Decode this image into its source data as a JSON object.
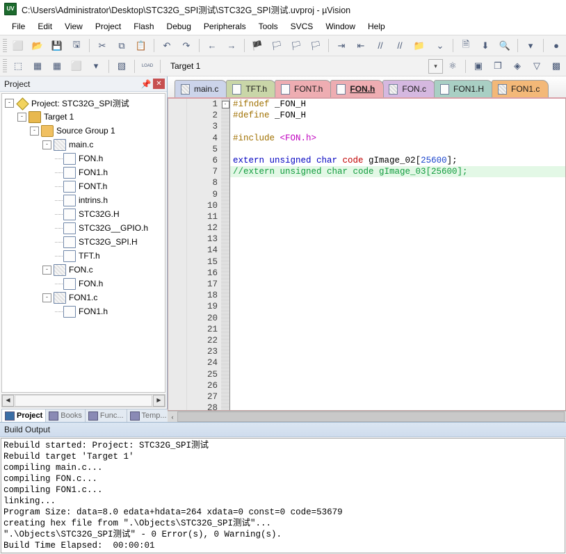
{
  "window": {
    "title": "C:\\Users\\Administrator\\Desktop\\STC32G_SPI测试\\STC32G_SPI测试.uvproj - µVision",
    "logo": "uv5-logo"
  },
  "menubar": {
    "items": [
      {
        "label": "File"
      },
      {
        "label": "Edit"
      },
      {
        "label": "View"
      },
      {
        "label": "Project"
      },
      {
        "label": "Flash"
      },
      {
        "label": "Debug"
      },
      {
        "label": "Peripherals"
      },
      {
        "label": "Tools"
      },
      {
        "label": "SVCS"
      },
      {
        "label": "Window"
      },
      {
        "label": "Help"
      }
    ]
  },
  "toolbar_main": {
    "buttons": [
      {
        "icon": "new-file-icon",
        "glyph": "⬜"
      },
      {
        "icon": "open-folder-icon",
        "glyph": "📂"
      },
      {
        "icon": "save-icon",
        "glyph": "💾"
      },
      {
        "icon": "save-all-icon",
        "glyph": "🖫"
      },
      {
        "icon": "cut-icon",
        "glyph": "✂"
      },
      {
        "icon": "copy-icon",
        "glyph": "⧉"
      },
      {
        "icon": "paste-icon",
        "glyph": "📋"
      },
      {
        "icon": "undo-icon",
        "glyph": "↶"
      },
      {
        "icon": "redo-icon",
        "glyph": "↷"
      },
      {
        "icon": "navigate-back-icon",
        "glyph": "←"
      },
      {
        "icon": "navigate-forward-icon",
        "glyph": "→"
      },
      {
        "icon": "bookmark-toggle-icon",
        "glyph": "🏴"
      },
      {
        "icon": "bookmark-prev-icon",
        "glyph": "🏳"
      },
      {
        "icon": "bookmark-next-icon",
        "glyph": "🏳"
      },
      {
        "icon": "bookmark-clear-icon",
        "glyph": "🏳"
      },
      {
        "icon": "indent-right-icon",
        "glyph": "⇥"
      },
      {
        "icon": "indent-left-icon",
        "glyph": "⇤"
      },
      {
        "icon": "comment-icon",
        "glyph": "//"
      },
      {
        "icon": "uncomment-icon",
        "glyph": "//"
      },
      {
        "icon": "open-file-ext-icon",
        "glyph": "📁"
      }
    ],
    "right_buttons": [
      {
        "icon": "dropdown-arrow-icon",
        "glyph": "⌄"
      },
      {
        "icon": "configure-target-icon",
        "glyph": "🗎"
      },
      {
        "icon": "download-icon",
        "glyph": "⬇"
      },
      {
        "icon": "find-in-files-icon",
        "glyph": "🔍"
      },
      {
        "icon": "find-dropdown-icon",
        "glyph": "▾"
      },
      {
        "icon": "status-circle-icon",
        "glyph": "●"
      }
    ]
  },
  "toolbar_build": {
    "buttons": [
      {
        "icon": "translate-icon",
        "glyph": "⬚"
      },
      {
        "icon": "build-icon",
        "glyph": "▦"
      },
      {
        "icon": "rebuild-all-icon",
        "glyph": "▦"
      },
      {
        "icon": "batch-build-icon",
        "glyph": "⬜"
      },
      {
        "icon": "batch-build-dropdown-icon",
        "glyph": "▾"
      },
      {
        "icon": "stop-build-icon",
        "glyph": "▧"
      },
      {
        "icon": "load-icon",
        "glyph": "LOAD"
      }
    ],
    "target_label": "Target 1",
    "target_dropdown_icon": "chevron-down-icon",
    "right_buttons": [
      {
        "icon": "target-options-icon",
        "glyph": "⚛"
      },
      {
        "icon": "manage-project-items-icon",
        "glyph": "▣"
      },
      {
        "icon": "multi-project-icon",
        "glyph": "❐"
      },
      {
        "icon": "pack-installer-icon",
        "glyph": "◈"
      },
      {
        "icon": "manage-run-time-icon",
        "glyph": "▽"
      },
      {
        "icon": "select-software-packs-icon",
        "glyph": "▩"
      }
    ]
  },
  "project_panel": {
    "title": "Project",
    "pin_icon": "pin-icon",
    "close_icon": "close-icon",
    "tree": [
      {
        "label": "Project: STC32G_SPI测试",
        "depth": 0,
        "icon": "project-icon",
        "expander": "-"
      },
      {
        "label": "Target 1",
        "depth": 1,
        "icon": "target-icon",
        "expander": "-"
      },
      {
        "label": "Source Group 1",
        "depth": 2,
        "icon": "folder-icon",
        "expander": "-"
      },
      {
        "label": "main.c",
        "depth": 3,
        "icon": "c-file-icon",
        "expander": "-"
      },
      {
        "label": "FON.h",
        "depth": 4,
        "icon": "h-file-icon",
        "expander": ""
      },
      {
        "label": "FON1.h",
        "depth": 4,
        "icon": "h-file-icon",
        "expander": ""
      },
      {
        "label": "FONT.h",
        "depth": 4,
        "icon": "h-file-icon",
        "expander": ""
      },
      {
        "label": "intrins.h",
        "depth": 4,
        "icon": "h-file-icon",
        "expander": ""
      },
      {
        "label": "STC32G.H",
        "depth": 4,
        "icon": "h-file-icon",
        "expander": ""
      },
      {
        "label": "STC32G__GPIO.h",
        "depth": 4,
        "icon": "h-file-icon",
        "expander": ""
      },
      {
        "label": "STC32G_SPI.H",
        "depth": 4,
        "icon": "h-file-icon",
        "expander": ""
      },
      {
        "label": "TFT.h",
        "depth": 4,
        "icon": "h-file-icon",
        "expander": ""
      },
      {
        "label": "FON.c",
        "depth": 3,
        "icon": "c-file-icon",
        "expander": "-"
      },
      {
        "label": "FON.h",
        "depth": 4,
        "icon": "h-file-icon",
        "expander": ""
      },
      {
        "label": "FON1.c",
        "depth": 3,
        "icon": "c-file-icon",
        "expander": "-"
      },
      {
        "label": "FON1.h",
        "depth": 4,
        "icon": "h-file-icon",
        "expander": ""
      }
    ],
    "scrollbar": {
      "left_arrow": "◀",
      "right_arrow": "▶"
    },
    "tabs": [
      {
        "label": "Project",
        "icon": "project-tab-icon",
        "active": true
      },
      {
        "label": "Books",
        "icon": "books-tab-icon",
        "active": false
      },
      {
        "label": "Func...",
        "icon": "functions-tab-icon",
        "active": false
      },
      {
        "label": "Temp...",
        "icon": "templates-tab-icon",
        "active": false
      }
    ]
  },
  "editor": {
    "tabs": [
      {
        "label": "main.c",
        "color": "#ccd4ea",
        "kind": "c",
        "active": false
      },
      {
        "label": "TFT.h",
        "color": "#c9d6a8",
        "kind": "h",
        "active": false
      },
      {
        "label": "FONT.h",
        "color": "#eeadb2",
        "kind": "h",
        "active": false
      },
      {
        "label": "FON.h",
        "color": "#eeadb2",
        "kind": "h",
        "active": true
      },
      {
        "label": "FON.c",
        "color": "#d5b8e0",
        "kind": "c",
        "active": false
      },
      {
        "label": "FON1.H",
        "color": "#a9cfc4",
        "kind": "h",
        "active": false
      },
      {
        "label": "FON1.c",
        "color": "#f3b878",
        "kind": "c",
        "active": false
      }
    ],
    "line_numbers": [
      1,
      2,
      3,
      4,
      5,
      6,
      7,
      8,
      9,
      10,
      11,
      12,
      13,
      14,
      15,
      16,
      17,
      18,
      19,
      20,
      21,
      22,
      23,
      24,
      25,
      26,
      27,
      28
    ],
    "fold_marker": "-",
    "lines": [
      {
        "n": 1,
        "highlight": false,
        "tokens": [
          {
            "t": "#ifndef ",
            "c": "pre"
          },
          {
            "t": "_FON_H",
            "c": "nrm"
          }
        ]
      },
      {
        "n": 2,
        "highlight": false,
        "tokens": [
          {
            "t": "#define ",
            "c": "pre"
          },
          {
            "t": "_FON_H",
            "c": "nrm"
          }
        ]
      },
      {
        "n": 3,
        "highlight": false,
        "tokens": []
      },
      {
        "n": 4,
        "highlight": false,
        "tokens": [
          {
            "t": "#include ",
            "c": "pre"
          },
          {
            "t": "<FON.h>",
            "c": "hdr"
          }
        ]
      },
      {
        "n": 5,
        "highlight": false,
        "tokens": []
      },
      {
        "n": 6,
        "highlight": false,
        "tokens": [
          {
            "t": "extern unsigned char ",
            "c": "kw"
          },
          {
            "t": "code ",
            "c": "typ"
          },
          {
            "t": "gImage_02",
            "c": "nrm"
          },
          {
            "t": "[",
            "c": "nrm"
          },
          {
            "t": "25600",
            "c": "num"
          },
          {
            "t": "];",
            "c": "nrm"
          }
        ]
      },
      {
        "n": 7,
        "highlight": true,
        "tokens": [
          {
            "t": "//extern unsigned char code gImage_03[25600];",
            "c": "cmt"
          }
        ]
      },
      {
        "n": 8,
        "highlight": false,
        "tokens": []
      }
    ],
    "hscroll": {
      "left_arrow": "‹"
    }
  },
  "build_output": {
    "title": "Build Output",
    "lines": [
      "Rebuild started: Project: STC32G_SPI测试",
      "Rebuild target 'Target 1'",
      "compiling main.c...",
      "compiling FON.c...",
      "compiling FON1.c...",
      "linking...",
      "Program Size: data=8.0 edata+hdata=264 xdata=0 const=0 code=53679",
      "creating hex file from \".\\Objects\\STC32G_SPI测试\"...",
      "\".\\Objects\\STC32G_SPI测试\" - 0 Error(s), 0 Warning(s).",
      "Build Time Elapsed:  00:00:01"
    ]
  },
  "colors": {
    "accent": "#3a6ea5",
    "active_tab_border": "#9e9e9e",
    "highlight_line": "#e3f8e6",
    "close_red": "#c75050"
  }
}
